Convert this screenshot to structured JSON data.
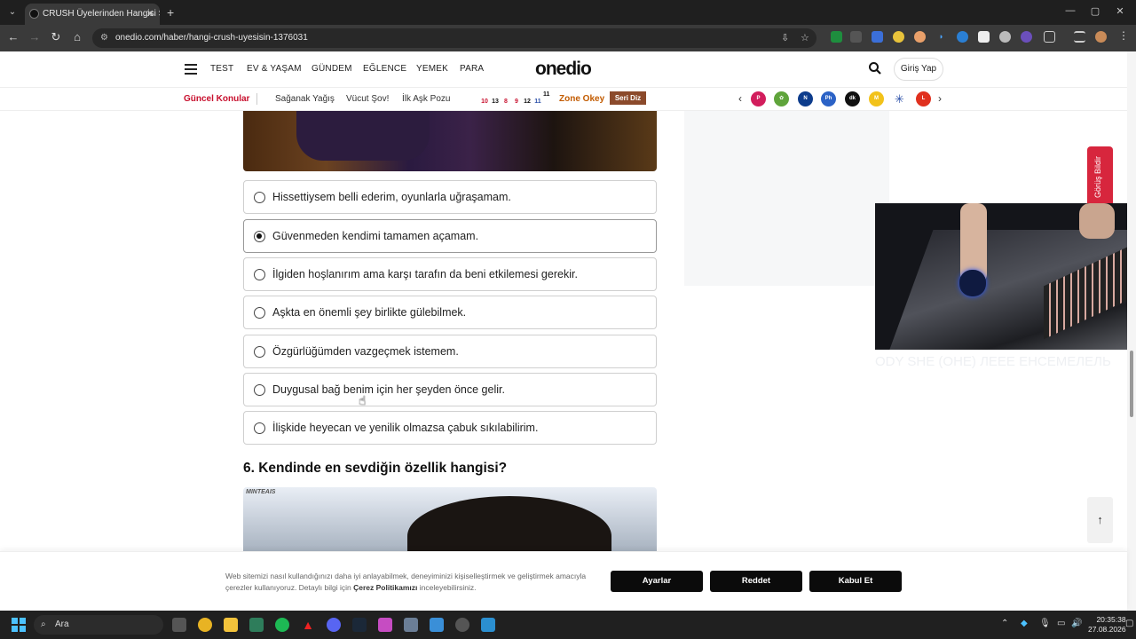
{
  "browser": {
    "tab_title": "CRUSH Üyelerinden Hangisi Se",
    "new_tab": "+",
    "url": "onedio.com/haber/hangi-crush-uyesisin-1376031",
    "window_controls": {
      "minimize": "—",
      "maximize": "▢",
      "close": "✕"
    }
  },
  "header": {
    "nav": [
      "TEST",
      "EV & YAŞAM",
      "GÜNDEM",
      "EĞLENCE",
      "YEMEK",
      "PARA"
    ],
    "logo": "onedio",
    "login": "Giriş Yap"
  },
  "topics": {
    "label": "Güncel Konular",
    "items": [
      "Sağanak Yağış",
      "Vücut Şov!",
      "İlk Aşk Pozu"
    ],
    "calendar": [
      "10",
      "13",
      "8",
      "9",
      "12",
      "11",
      "11"
    ],
    "zone": "Zone Okey",
    "badge": "Seri Diz"
  },
  "brand_icons": [
    "pepsi-icon",
    "tree-icon",
    "nivea-icon",
    "philips-icon",
    "dk-icon",
    "maxi-icon",
    "snowflake-icon",
    "lays-icon"
  ],
  "quiz": {
    "options": [
      {
        "text": "Hissettiysem belli ederim, oyunlarla uğraşamam.",
        "selected": false
      },
      {
        "text": "Güvenmeden kendimi tamamen açamam.",
        "selected": true
      },
      {
        "text": "İlgiden hoşlanırım ama karşı tarafın da beni etkilemesi gerekir.",
        "selected": false
      },
      {
        "text": "Aşkta en önemli şey birlikte gülebilmek.",
        "selected": false
      },
      {
        "text": "Özgürlüğümden vazgeçmek istemem.",
        "selected": false
      },
      {
        "text": "Duygusal bağ benim için her şeyden önce gelir.",
        "selected": false
      },
      {
        "text": "İlişkide heyecan ve yenilik olmazsa çabuk sıkılabilirim.",
        "selected": false
      }
    ],
    "next_question": "6. Kendinde en sevdiğin özellik hangisi?",
    "image_watermark": "MINTEAIS"
  },
  "sidebar": {
    "feedback": "Görüş Bildir",
    "video_caption": "ODY SHE (ОНЕ) ЛЕЕЕ ЕНСЕМЕЛЕЛЬ",
    "scroll_top": "↑"
  },
  "cookie": {
    "text_before": "Web sitemizi nasıl kullandığınızı daha iyi anlayabilmek, deneyiminizi kişiselleştirmek ve geliştirmek amacıyla çerezler kullanıyoruz. Detaylı bilgi için ",
    "policy_link": "Çerez Politikamızı",
    "text_after": " inceleyebilirsiniz.",
    "buttons": {
      "settings": "Ayarlar",
      "reject": "Reddet",
      "accept": "Kabul Et"
    }
  },
  "taskbar": {
    "search_placeholder": "Ara",
    "time": "20:35:38",
    "date": "27.08.2026"
  },
  "colors": {
    "accent_red": "#c8102e",
    "cookie_button": "#0b0b0b",
    "feedback": "#d7263d"
  }
}
